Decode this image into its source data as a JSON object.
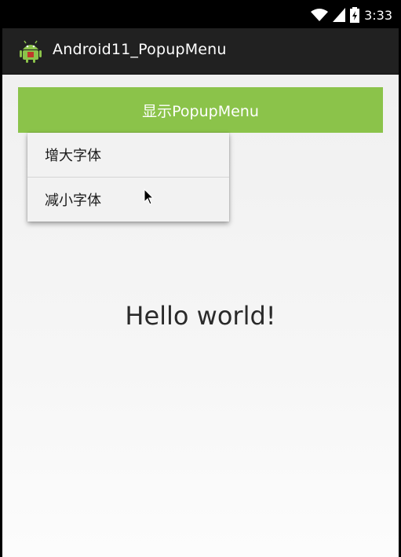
{
  "status_bar": {
    "time": "3:33",
    "icons": [
      "wifi-icon",
      "signal-icon",
      "battery-icon"
    ]
  },
  "action_bar": {
    "title": "Android11_PopupMenu",
    "icon": "android-icon"
  },
  "main": {
    "show_button_label": "显示PopupMenu",
    "hello_text": "Hello world!"
  },
  "popup_menu": {
    "items": [
      {
        "label": "增大字体"
      },
      {
        "label": "减小字体"
      }
    ]
  },
  "colors": {
    "accent_green": "#8bc34a",
    "action_bar": "#212121",
    "status_bar": "#000000"
  }
}
